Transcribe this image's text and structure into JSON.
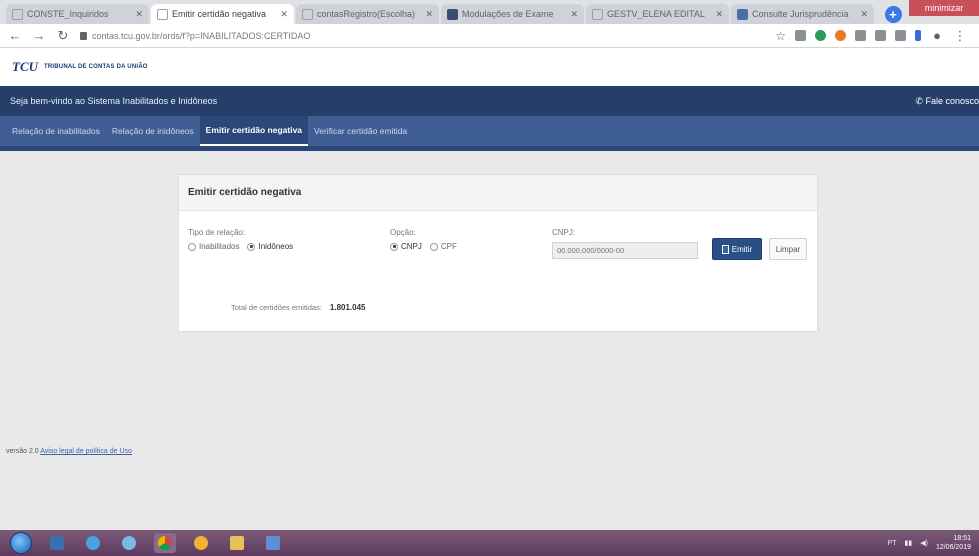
{
  "browser": {
    "tabs": [
      {
        "title": "CONSTE_Inquiridos",
        "active": false
      },
      {
        "title": "Emitir certidão negativa",
        "active": true
      },
      {
        "title": "contasRegistro(Escolha)",
        "active": false
      },
      {
        "title": "Modulações de Exame",
        "active": false
      },
      {
        "title": "GESTV_ELENA EDITAL",
        "active": false
      },
      {
        "title": "Consulte Jurisprudência",
        "active": false
      }
    ],
    "address": "contas.tcu.gov.br/ords/f?p=INABILITADOS:CERTIDAO",
    "window_control": "minimizar"
  },
  "site": {
    "logo_mark": "TCU",
    "logo_text": "TRIBUNAL DE CONTAS DA UNIÃO",
    "welcome": "Seja bem-vindo ao Sistema Inabilitados e Inidôneos",
    "contact": "✆ Fale conosco",
    "menu": [
      {
        "label": "Relação de inabilitados",
        "active": false
      },
      {
        "label": "Relação de inidôneos",
        "active": false
      },
      {
        "label": "Emitir certidão negativa",
        "active": true
      },
      {
        "label": "Verificar certidão emitida",
        "active": false
      }
    ]
  },
  "form": {
    "title": "Emitir certidão negativa",
    "relation": {
      "label": "Tipo de relação:",
      "options": [
        {
          "label": "Inabilitados",
          "checked": false
        },
        {
          "label": "Inidôneos",
          "checked": true
        }
      ]
    },
    "option": {
      "label": "Opção:",
      "options": [
        {
          "label": "CNPJ",
          "checked": true
        },
        {
          "label": "CPF",
          "checked": false
        }
      ]
    },
    "cnpj": {
      "label": "CNPJ:",
      "placeholder": "00.000.000/0000-00",
      "value": ""
    },
    "emit_button": "Emitir",
    "clear_button": "Limpar",
    "total_label": "Total de certidões emitidas:",
    "total_value": "1.801.045"
  },
  "footer": {
    "version": "versão 2.0",
    "link": "Aviso legal de política de Uso"
  },
  "taskbar": {
    "tray": "PT",
    "time": "18:51",
    "date": "12/06/2019"
  }
}
